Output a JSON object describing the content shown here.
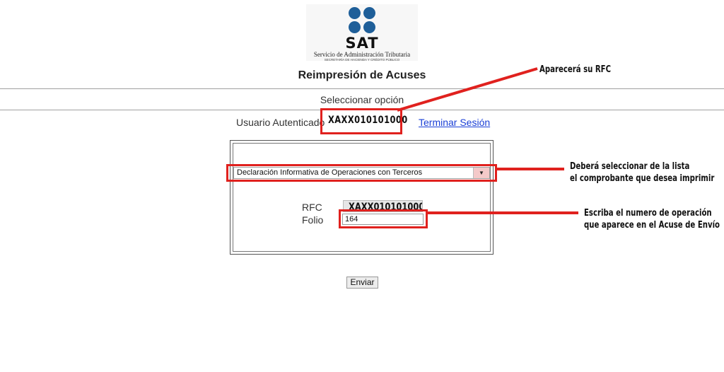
{
  "logo": {
    "wordmark": "SAT",
    "line1": "Servicio de Administración Tributaria",
    "line2": "SECRETARÍA DE HACIENDA Y CRÉDITO PÚBLICO",
    "dot_color": "#1f5f99"
  },
  "header": {
    "title": "Reimpresión de Acuses",
    "subtitle": "Seleccionar opción"
  },
  "session": {
    "user_label": "Usuario Autenticado",
    "rfc": "XAXX010101000",
    "logout_link": "Terminar Sesión"
  },
  "form": {
    "select_value": "Declaración Informativa de Operaciones con Terceros",
    "rfc_label": "RFC",
    "rfc_value": "XAXX010101000",
    "folio_label": "Folio",
    "folio_value": "164",
    "submit_label": "Enviar"
  },
  "annotations": {
    "rfc_note": "Aparecerá su RFC",
    "select_note_line1": "Deberá seleccionar de la lista",
    "select_note_line2": "el comprobante que desea imprimir",
    "folio_note_line1": "Escriba el numero de operación",
    "folio_note_line2": "que aparece en el Acuse de Envío",
    "highlight_color": "#e0211e"
  }
}
